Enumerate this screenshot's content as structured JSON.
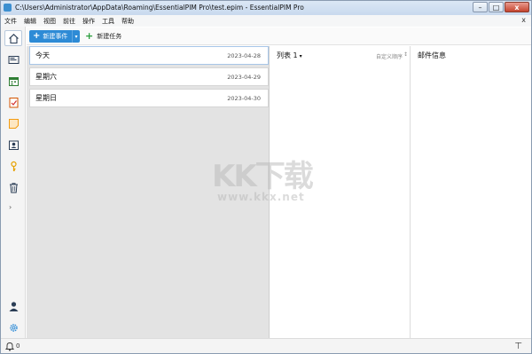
{
  "window": {
    "title": "C:\\Users\\Administrator\\AppData\\Roaming\\EssentialPIM Pro\\test.epim - EssentialPIM Pro",
    "controls": {
      "minimize": "–",
      "maximize": "□",
      "close": "x"
    }
  },
  "menu": {
    "items": [
      "文件",
      "编辑",
      "视图",
      "前往",
      "操作",
      "工具",
      "帮助"
    ],
    "close_glyph": "x"
  },
  "toolbar": {
    "new_event_label": "新建事件",
    "new_event_plus": "+",
    "new_event_dropdown": "▾",
    "new_task_label": "新建任务",
    "new_task_plus": "+"
  },
  "rail": {
    "icons": [
      "home-icon",
      "mail-icon",
      "calendar-icon",
      "tasks-icon",
      "notes-icon",
      "contacts-icon",
      "passwords-icon",
      "trash-icon"
    ],
    "expand": "›",
    "bottom_icons": [
      "account-icon",
      "settings-icon"
    ]
  },
  "days": [
    {
      "name": "今天",
      "date": "2023-04-28",
      "selected": true
    },
    {
      "name": "星期六",
      "date": "2023-04-29",
      "selected": false
    },
    {
      "name": "星期日",
      "date": "2023-04-30",
      "selected": false
    }
  ],
  "list_pane": {
    "title": "列表 1",
    "dropdown": "▾",
    "sort_label": "自定义顺序",
    "sort_icon": "↕"
  },
  "mail_pane": {
    "title": "邮件信息"
  },
  "status": {
    "reminder_count": "0",
    "pin_glyph": "⊤"
  },
  "watermark": {
    "logo": "KK下载",
    "url": "www.kkx.net"
  }
}
